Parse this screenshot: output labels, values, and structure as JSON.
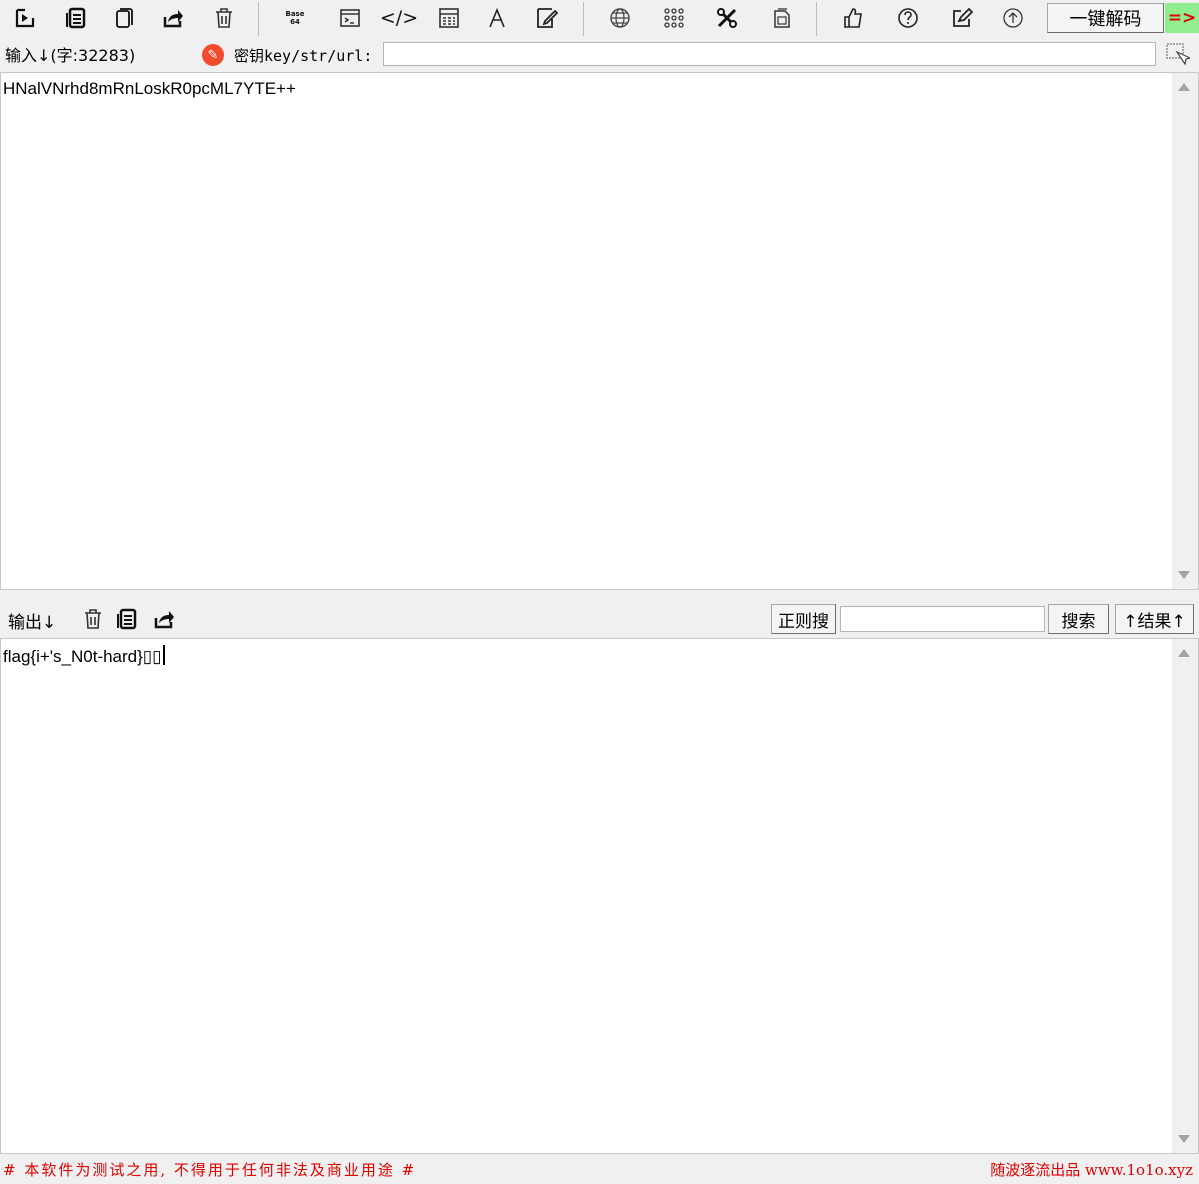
{
  "toolbar": {
    "icons": [
      "import-icon",
      "copy-icon",
      "paste-icon",
      "share-icon",
      "trash-icon",
      "base64-icon",
      "terminal-icon",
      "code-icon",
      "calculator-icon",
      "font-icon",
      "edit-doc-icon",
      "globe-icon",
      "grid-icon",
      "tools-icon",
      "file-icon",
      "like-icon",
      "help-icon",
      "edit-icon",
      "upload-icon"
    ],
    "base_icon_text": "Base\n64",
    "decode_button_label": "一键解码",
    "arrow_button_label": "=>",
    "arrow_button_bg": "#90ee90",
    "arrow_button_color": "#e00000"
  },
  "input_section": {
    "label": "输入↓(字:32283)",
    "key_label": "密钥key/str/url:",
    "key_value": "",
    "text": "HNalVNrhd8mRnLoskR0pcML7YTE++"
  },
  "output_section": {
    "label": "输出↓",
    "regex_search_label": "正则搜",
    "search_value": "",
    "search_button_label": "搜索",
    "result_button_label": "↑结果↑",
    "text": "flag{i+'s_N0t-hard}▯▯"
  },
  "footer": {
    "disclaimer": "# 本软件为测试之用, 不得用于任何非法及商业用途 #",
    "credit": "随波逐流出品 www.1o1o.xyz",
    "text_color": "#e00000"
  }
}
